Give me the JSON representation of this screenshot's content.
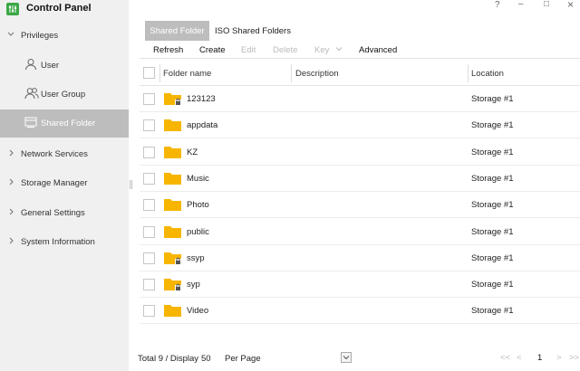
{
  "app": {
    "title": "Control Panel"
  },
  "window_controls": {
    "help": "?",
    "minimize": "–",
    "maximize": "□",
    "close": "×"
  },
  "sidebar": {
    "sections": [
      {
        "label": "Privileges",
        "expanded": true
      },
      {
        "label": "Network Services"
      },
      {
        "label": "Storage Manager"
      },
      {
        "label": "General Settings"
      },
      {
        "label": "System Information"
      }
    ],
    "sub_items": [
      {
        "label": "User",
        "icon": "user-icon"
      },
      {
        "label": "User Group",
        "icon": "user-group-icon"
      },
      {
        "label": "Shared Folder",
        "icon": "shared-folder-icon",
        "active": true
      }
    ]
  },
  "tabs": [
    {
      "label": "Shared Folder",
      "active": true
    },
    {
      "label": "ISO Shared Folders"
    }
  ],
  "toolbar": {
    "refresh": "Refresh",
    "create": "Create",
    "edit": "Edit",
    "delete": "Delete",
    "key": "Key",
    "advanced": "Advanced"
  },
  "table": {
    "headers": {
      "name": "Folder name",
      "description": "Description",
      "location": "Location"
    },
    "rows": [
      {
        "name": "123123",
        "location": "Storage #1",
        "locked": true
      },
      {
        "name": "appdata",
        "location": "Storage #1",
        "locked": false
      },
      {
        "name": "KZ",
        "location": "Storage #1",
        "locked": false
      },
      {
        "name": "Music",
        "location": "Storage #1",
        "locked": false
      },
      {
        "name": "Photo",
        "location": "Storage #1",
        "locked": false
      },
      {
        "name": "public",
        "location": "Storage #1",
        "locked": false
      },
      {
        "name": "ssyp",
        "location": "Storage #1",
        "locked": true
      },
      {
        "name": "syp",
        "location": "Storage #1",
        "locked": true
      },
      {
        "name": "Video",
        "location": "Storage #1",
        "locked": false
      }
    ]
  },
  "footer": {
    "total": "Total 9 / Display",
    "per_page_value": "50",
    "per_page_label": "Per Page",
    "first": "<<",
    "prev": "<",
    "page": "1",
    "next": ">",
    "last": ">>"
  },
  "colors": {
    "folder": "#f7b500",
    "active_bg": "#bdbdbd",
    "logo": "#3aa845"
  }
}
